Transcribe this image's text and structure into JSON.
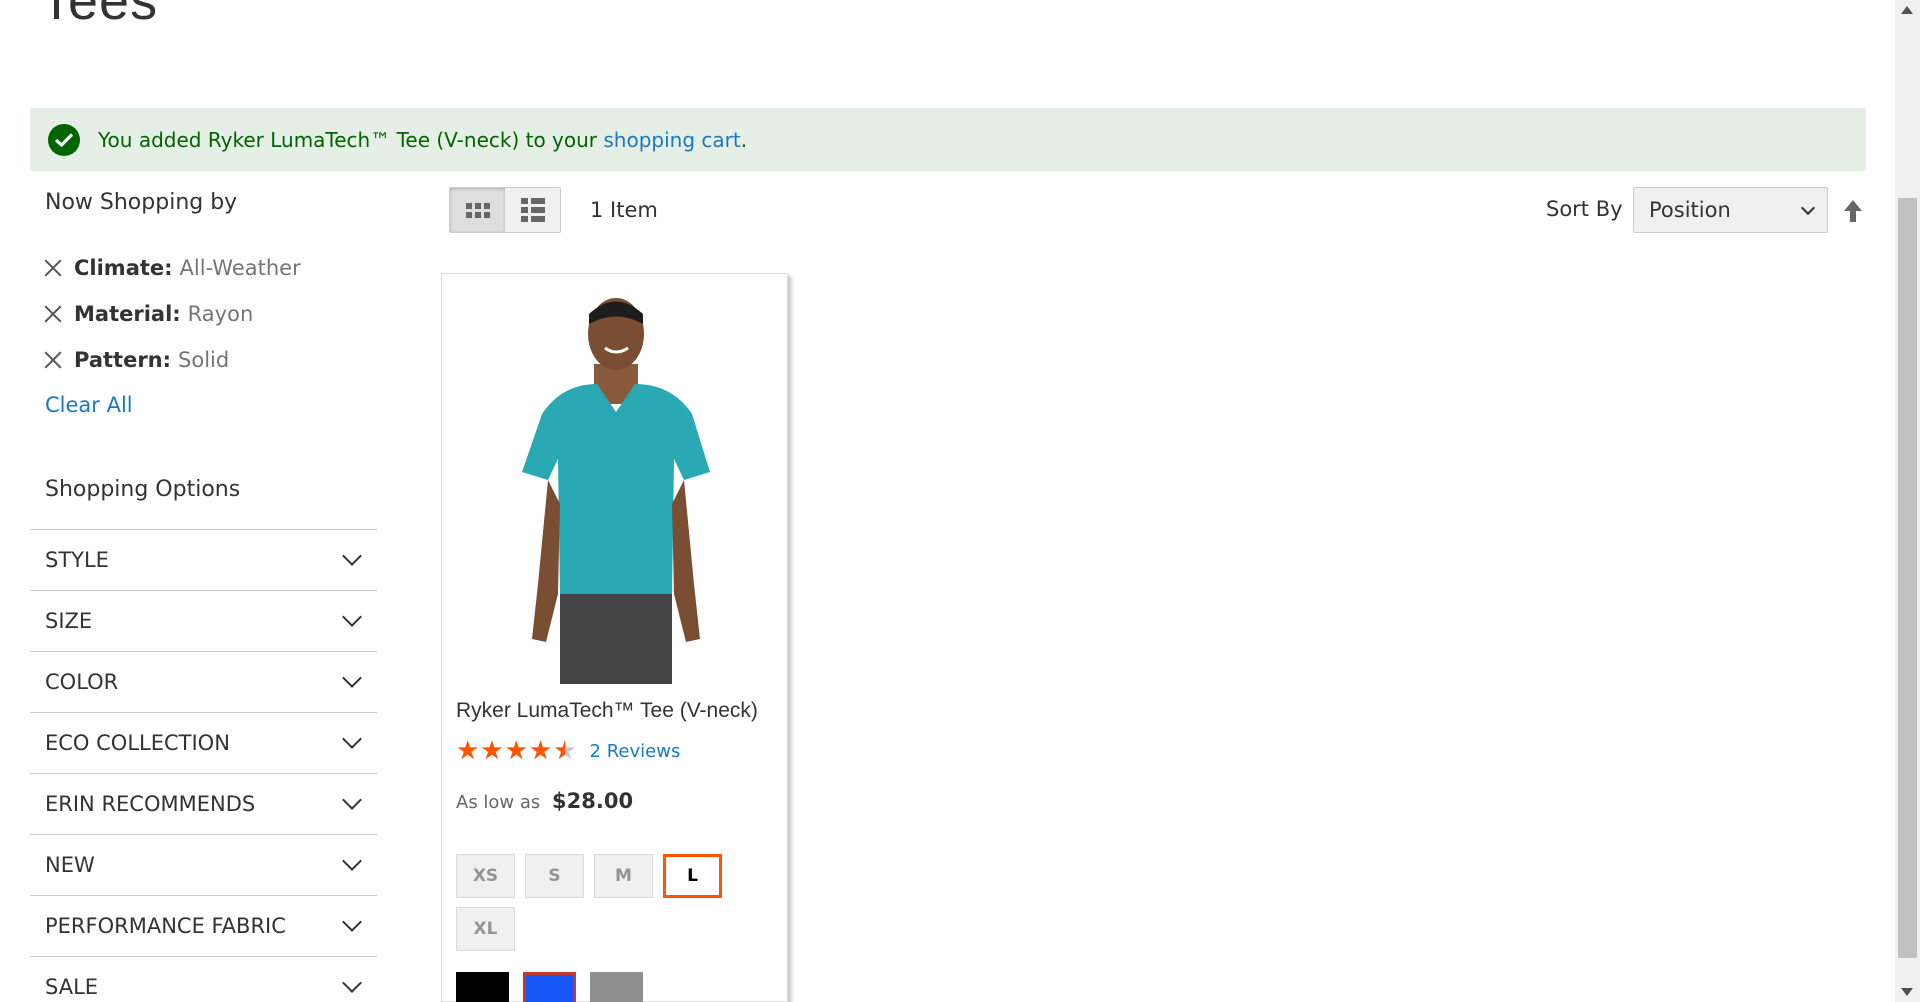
{
  "page": {
    "title": "Tees"
  },
  "message": {
    "prefix": "You added Ryker LumaTech™ Tee (V-neck) to your ",
    "link": "shopping cart",
    "suffix": "."
  },
  "sidebar": {
    "now_shopping_title": "Now Shopping by",
    "filters": [
      {
        "label": "Climate:",
        "value": "All-Weather"
      },
      {
        "label": "Material:",
        "value": "Rayon"
      },
      {
        "label": "Pattern:",
        "value": "Solid"
      }
    ],
    "clear_all": "Clear All",
    "shopping_options_title": "Shopping Options",
    "options": [
      "STYLE",
      "SIZE",
      "COLOR",
      "ECO COLLECTION",
      "ERIN RECOMMENDS",
      "NEW",
      "PERFORMANCE FABRIC",
      "SALE"
    ]
  },
  "toolbar": {
    "item_count": "1 Item",
    "sort_label": "Sort By",
    "sort_value": "Position",
    "view_mode": "grid"
  },
  "product": {
    "name": "Ryker LumaTech™ Tee (V-neck)",
    "rating_percent": 90,
    "reviews": "2 Reviews",
    "price_prefix": "As low as",
    "price": "$28.00",
    "sizes": [
      "XS",
      "S",
      "M",
      "L",
      "XL"
    ],
    "selected_size": "L",
    "swatches": [
      {
        "name": "Black",
        "color": "#000000"
      },
      {
        "name": "Blue",
        "color": "#1857f7"
      },
      {
        "name": "Gray",
        "color": "#8f8f8f"
      }
    ],
    "selected_swatch": "Blue",
    "shirt_color": "#2aa8b3"
  },
  "colors": {
    "accent": "#ff5501",
    "link": "#1979c3",
    "success_bg": "#e5efe5",
    "success_text": "#006400"
  }
}
